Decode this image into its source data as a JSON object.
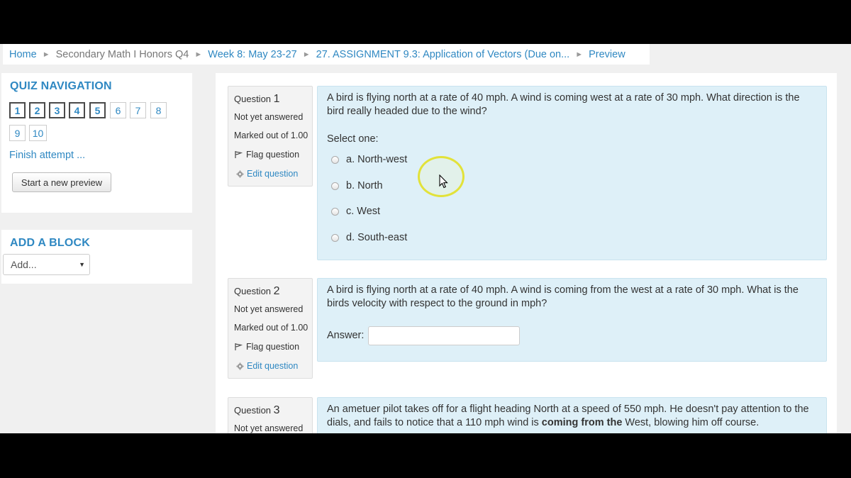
{
  "breadcrumb": {
    "items": [
      {
        "label": "Home",
        "link": true
      },
      {
        "label": "Secondary Math I Honors Q4",
        "link": false
      },
      {
        "label": "Week 8: May 23-27",
        "link": true
      },
      {
        "label": "27. ASSIGNMENT 9.3: Application of Vectors (Due on...",
        "link": true
      },
      {
        "label": "Preview",
        "link": true
      }
    ],
    "separator": "►"
  },
  "quiz_navigation": {
    "title": "QUIZ NAVIGATION",
    "buttons": [
      "1",
      "2",
      "3",
      "4",
      "5",
      "6",
      "7",
      "8",
      "9",
      "10"
    ],
    "finish_label": "Finish attempt ...",
    "new_preview_label": "Start a new preview"
  },
  "add_block": {
    "title": "ADD A BLOCK",
    "select_value": "Add..."
  },
  "questions": [
    {
      "label": "Question",
      "number": "1",
      "status": "Not yet answered",
      "marks": "Marked out of 1.00",
      "flag_label": "Flag question",
      "edit_label": "Edit question",
      "text": "A bird is flying north at a rate of 40 mph.  A wind is coming west at a rate of 30 mph.  What direction is the bird really headed due to the wind?",
      "prompt": "Select one:",
      "options": [
        "a. North-west",
        "b. North",
        "c. West",
        "d. South-east"
      ]
    },
    {
      "label": "Question",
      "number": "2",
      "status": "Not yet answered",
      "marks": "Marked out of 1.00",
      "flag_label": "Flag question",
      "edit_label": "Edit question",
      "text": "A bird is flying north at a rate of 40 mph.  A wind is coming from the west at a rate of 30 mph.  What is the birds velocity with respect to the ground in mph?",
      "answer_label": "Answer:",
      "answer_value": ""
    },
    {
      "label": "Question",
      "number": "3",
      "status": "Not yet answered",
      "text_before": "An ametuer pilot takes off for a flight heading North at a speed of 550 mph.  He doesn't pay attention to the dials, and fails to notice that a 110 mph wind is ",
      "text_bold": "coming from the",
      "text_after": " West, blowing him off course."
    }
  ],
  "colors": {
    "link": "#2f88c2",
    "question_bg": "#def0f8",
    "info_bg": "#f3f3f3",
    "cursor_highlight": "#e2e23a"
  }
}
